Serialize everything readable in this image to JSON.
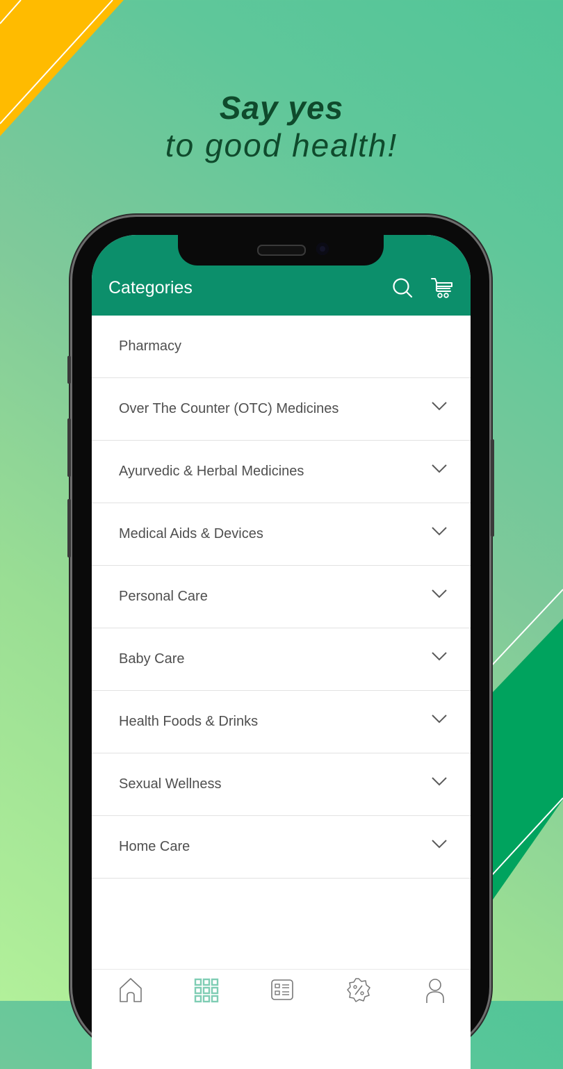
{
  "promo": {
    "headline_line1": "Say yes",
    "headline_line2": "to good health!"
  },
  "colors": {
    "brand": "#0c8f6b",
    "headline": "#0f4a2c",
    "accent_yellow": "#ffbb00",
    "accent_green": "#00a35e",
    "active_nav": "#7fcdb4"
  },
  "appbar": {
    "title": "Categories",
    "icons": [
      "search-icon",
      "cart-icon"
    ]
  },
  "categories": [
    {
      "label": "Pharmacy",
      "expandable": false
    },
    {
      "label": "Over The Counter (OTC) Medicines",
      "expandable": true
    },
    {
      "label": "Ayurvedic & Herbal Medicines",
      "expandable": true
    },
    {
      "label": "Medical Aids & Devices",
      "expandable": true
    },
    {
      "label": "Personal Care",
      "expandable": true
    },
    {
      "label": "Baby Care",
      "expandable": true
    },
    {
      "label": "Health Foods & Drinks",
      "expandable": true
    },
    {
      "label": "Sexual Wellness",
      "expandable": true
    },
    {
      "label": "Home Care",
      "expandable": true
    }
  ],
  "bottom_nav": [
    {
      "icon": "home-icon",
      "active": false
    },
    {
      "icon": "categories-grid-icon",
      "active": true
    },
    {
      "icon": "orders-list-icon",
      "active": false
    },
    {
      "icon": "offers-percent-icon",
      "active": false
    },
    {
      "icon": "profile-icon",
      "active": false
    }
  ]
}
